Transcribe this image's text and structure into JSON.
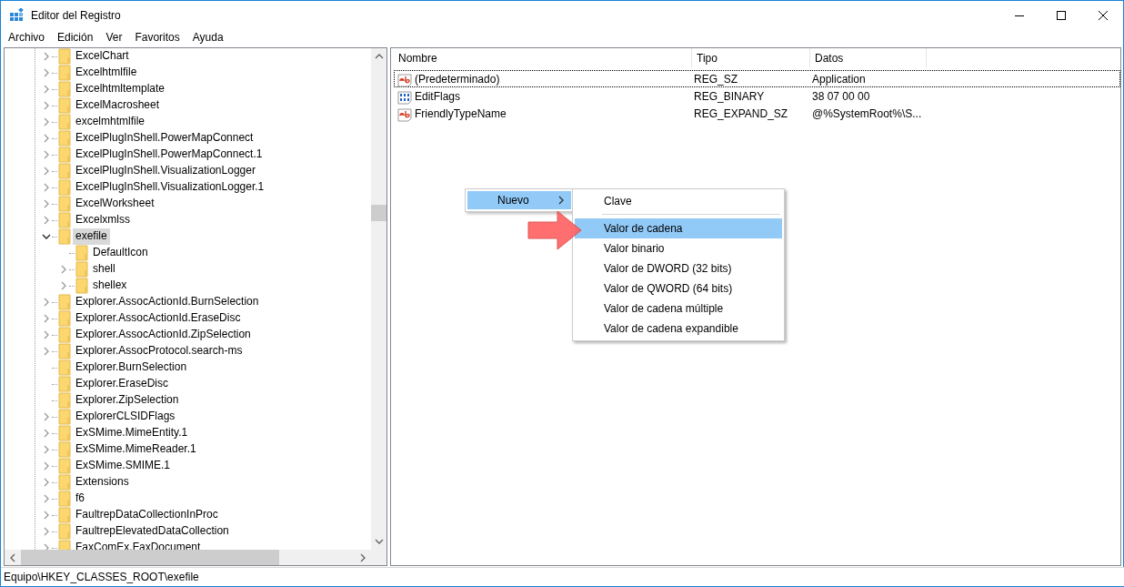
{
  "window": {
    "title": "Editor del Registro"
  },
  "menu_bar": [
    "Archivo",
    "Edición",
    "Ver",
    "Favoritos",
    "Ayuda"
  ],
  "tree": {
    "items": [
      {
        "label": "ExcelChart",
        "kind": "expandable",
        "expanded": false,
        "selected": false
      },
      {
        "label": "Excelhtmlfile",
        "kind": "expandable",
        "expanded": false,
        "selected": false
      },
      {
        "label": "Excelhtmltemplate",
        "kind": "expandable",
        "expanded": false,
        "selected": false
      },
      {
        "label": "ExcelMacrosheet",
        "kind": "expandable",
        "expanded": false,
        "selected": false
      },
      {
        "label": "excelmhtmlfile",
        "kind": "expandable",
        "expanded": false,
        "selected": false
      },
      {
        "label": "ExcelPlugInShell.PowerMapConnect",
        "kind": "expandable",
        "expanded": false,
        "selected": false
      },
      {
        "label": "ExcelPlugInShell.PowerMapConnect.1",
        "kind": "expandable",
        "expanded": false,
        "selected": false
      },
      {
        "label": "ExcelPlugInShell.VisualizationLogger",
        "kind": "expandable",
        "expanded": false,
        "selected": false
      },
      {
        "label": "ExcelPlugInShell.VisualizationLogger.1",
        "kind": "expandable",
        "expanded": false,
        "selected": false
      },
      {
        "label": "ExcelWorksheet",
        "kind": "expandable",
        "expanded": false,
        "selected": false
      },
      {
        "label": "Excelxmlss",
        "kind": "expandable",
        "expanded": false,
        "selected": false
      },
      {
        "label": "exefile",
        "kind": "expandable",
        "expanded": true,
        "selected": true,
        "children": [
          {
            "label": "DefaultIcon",
            "kind": "leaf",
            "selected": false
          },
          {
            "label": "shell",
            "kind": "expandable",
            "expanded": false,
            "selected": false
          },
          {
            "label": "shellex",
            "kind": "expandable",
            "expanded": false,
            "selected": false
          }
        ]
      },
      {
        "label": "Explorer.AssocActionId.BurnSelection",
        "kind": "expandable",
        "expanded": false,
        "selected": false
      },
      {
        "label": "Explorer.AssocActionId.EraseDisc",
        "kind": "expandable",
        "expanded": false,
        "selected": false
      },
      {
        "label": "Explorer.AssocActionId.ZipSelection",
        "kind": "expandable",
        "expanded": false,
        "selected": false
      },
      {
        "label": "Explorer.AssocProtocol.search-ms",
        "kind": "expandable",
        "expanded": false,
        "selected": false
      },
      {
        "label": "Explorer.BurnSelection",
        "kind": "leaf",
        "selected": false
      },
      {
        "label": "Explorer.EraseDisc",
        "kind": "leaf",
        "selected": false
      },
      {
        "label": "Explorer.ZipSelection",
        "kind": "leaf",
        "selected": false
      },
      {
        "label": "ExplorerCLSIDFlags",
        "kind": "expandable",
        "expanded": false,
        "selected": false
      },
      {
        "label": "ExSMime.MimeEntity.1",
        "kind": "expandable",
        "expanded": false,
        "selected": false
      },
      {
        "label": "ExSMime.MimeReader.1",
        "kind": "expandable",
        "expanded": false,
        "selected": false
      },
      {
        "label": "ExSMime.SMIME.1",
        "kind": "expandable",
        "expanded": false,
        "selected": false
      },
      {
        "label": "Extensions",
        "kind": "expandable",
        "expanded": false,
        "selected": false
      },
      {
        "label": "f6",
        "kind": "expandable",
        "expanded": false,
        "selected": false
      },
      {
        "label": "FaultrepDataCollectionInProc",
        "kind": "expandable",
        "expanded": false,
        "selected": false
      },
      {
        "label": "FaultrepElevatedDataCollection",
        "kind": "expandable",
        "expanded": false,
        "selected": false
      },
      {
        "label": "FaxComEx.FaxDocument",
        "kind": "expandable",
        "expanded": false,
        "selected": false
      }
    ]
  },
  "values": {
    "columns": [
      "Nombre",
      "Tipo",
      "Datos"
    ],
    "rows": [
      {
        "kind": "string",
        "name": "(Predeterminado)",
        "type": "REG_SZ",
        "data": "Application",
        "focused": true
      },
      {
        "kind": "binary",
        "name": "EditFlags",
        "type": "REG_BINARY",
        "data": "38 07 00 00",
        "focused": false
      },
      {
        "kind": "string",
        "name": "FriendlyTypeName",
        "type": "REG_EXPAND_SZ",
        "data": "@%SystemRoot%\\S...",
        "focused": false
      }
    ]
  },
  "context_menu": {
    "items": [
      {
        "label": "Nuevo",
        "selected": true
      }
    ],
    "submenu": [
      {
        "kind": "item",
        "label": "Clave",
        "selected": false
      },
      {
        "kind": "separator"
      },
      {
        "kind": "item",
        "label": "Valor de cadena",
        "selected": true
      },
      {
        "kind": "item",
        "label": "Valor binario",
        "selected": false
      },
      {
        "kind": "item",
        "label": "Valor de DWORD (32 bits)",
        "selected": false
      },
      {
        "kind": "item",
        "label": "Valor de QWORD (64 bits)",
        "selected": false
      },
      {
        "kind": "item",
        "label": "Valor de cadena múltiple",
        "selected": false
      },
      {
        "kind": "item",
        "label": "Valor de cadena expandible",
        "selected": false
      }
    ]
  },
  "status_bar": {
    "path": "Equipo\\HKEY_CLASSES_ROOT\\exefile"
  }
}
